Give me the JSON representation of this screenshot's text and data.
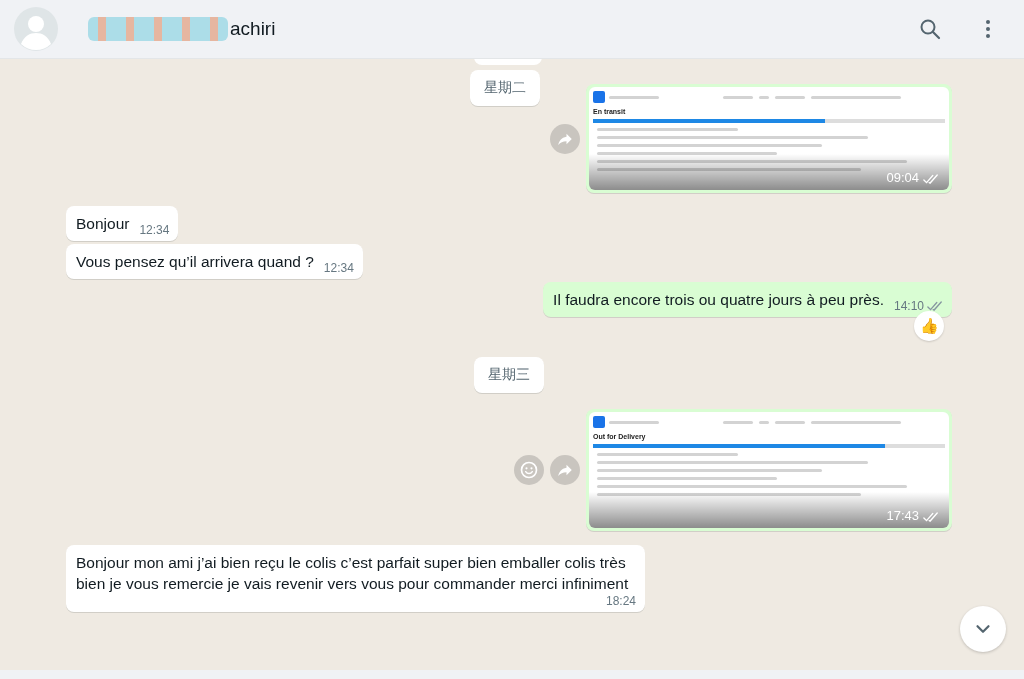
{
  "header": {
    "contact_name": "achiri"
  },
  "messages": [
    {
      "kind": "date",
      "text": "星期二"
    },
    {
      "kind": "image",
      "title": "En transit",
      "progress": {
        "level": 0.66
      },
      "time": "09:04",
      "react": false
    },
    {
      "kind": "incoming",
      "text": "Bonjour",
      "time": "12:34"
    },
    {
      "kind": "incoming",
      "text": "Vous pensez qu’il arrivera quand ?",
      "time": "12:34"
    },
    {
      "kind": "outgoing",
      "text": "Il faudra encore trois ou quatre jours à peu près.",
      "time": "14:10",
      "reaction": "👍"
    },
    {
      "kind": "date",
      "text": "星期三"
    },
    {
      "kind": "image",
      "title": "Out for Delivery",
      "progress": {
        "level": 0.83
      },
      "time": "17:43",
      "react": true
    },
    {
      "kind": "incoming",
      "text": "Bonjour mon ami j’ai bien reçu le colis c’est parfait super bien emballer colis très bien je vous remercie je vais revenir vers vous pour commander merci infiniment",
      "time": "18:24"
    }
  ]
}
